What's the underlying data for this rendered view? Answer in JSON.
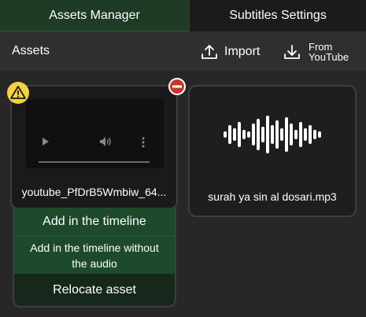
{
  "tabs": [
    {
      "label": "Assets Manager",
      "active": true
    },
    {
      "label": "Subtitles Settings",
      "active": false
    }
  ],
  "toolbar": {
    "title": "Assets",
    "import_label": "Import",
    "youtube_label_line1": "From",
    "youtube_label_line2": "YouTube"
  },
  "assets": [
    {
      "name": "youtube_PfDrB5Wmbiw_64...",
      "kind": "video",
      "status": "warning"
    },
    {
      "name": "surah ya sin al dosari.mp3",
      "kind": "audio"
    }
  ],
  "context_menu": {
    "items": [
      "Add in the timeline",
      "Add in the timeline without the audio",
      "Relocate asset"
    ]
  },
  "colors": {
    "active_tab": "#1f3a25",
    "menu_green": "#1d4a2a",
    "warning": "#f5d142",
    "remove": "#c0392b"
  }
}
